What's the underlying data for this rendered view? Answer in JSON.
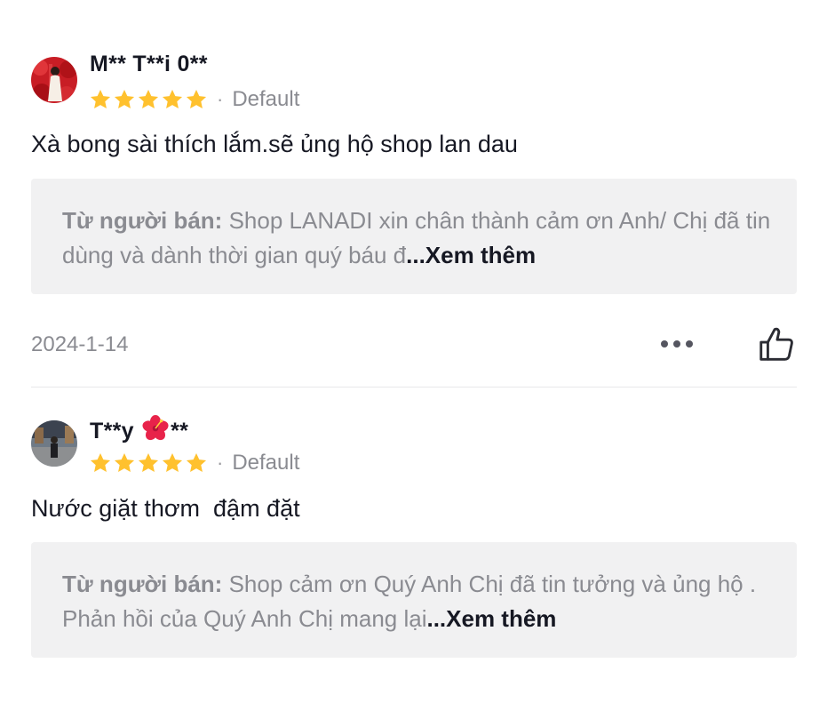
{
  "reviews": [
    {
      "username": "M** T**i 0**",
      "rating": 5,
      "variant": "Default",
      "separator": "·",
      "text": "Xà bong sài thích lắm.sẽ ủng hộ shop lan dau",
      "seller_reply_label": "Từ người bán:",
      "seller_reply": " Shop LANADI xin chân thành cảm ơn Anh/ Chị đã tin dùng và dành thời gian quý báu đ",
      "see_more": "...Xem thêm",
      "date": "2024-1-14"
    },
    {
      "username_prefix": "T**y ",
      "username_emoji": "hibiscus-icon",
      "username_suffix": "**",
      "rating": 5,
      "variant": "Default",
      "separator": "·",
      "text": "Nước giặt thơm  đậm đặt",
      "seller_reply_label": "Từ người bán:",
      "seller_reply": " Shop cảm ơn Quý Anh Chị  đã tin tưởng và ủng hộ . Phản hồi của Quý Anh Chị mang lại",
      "see_more": "...Xem thêm"
    }
  ],
  "colors": {
    "star": "#FFC12E",
    "text_primary": "#161823",
    "text_secondary": "#8A8B91",
    "seller_box_bg": "#F1F1F2"
  },
  "icons": [
    "star-icon",
    "more-options-icon",
    "thumbs-up-icon",
    "hibiscus-icon"
  ]
}
